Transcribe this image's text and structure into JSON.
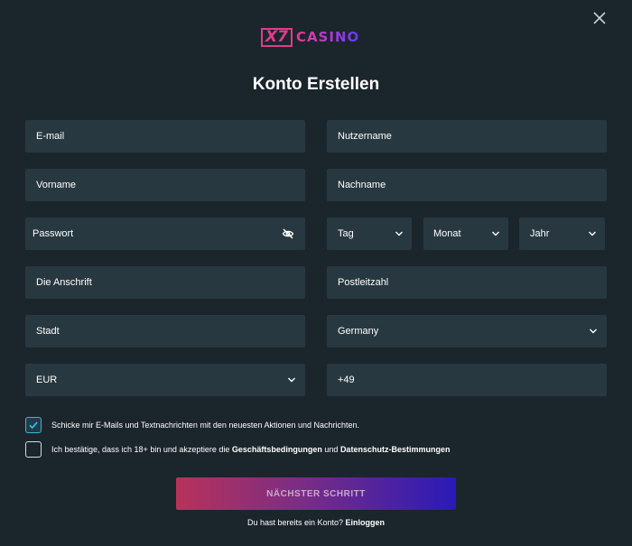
{
  "brand": {
    "logo_mark": "X7",
    "logo_word": "CASINO",
    "colors": {
      "pink": "#e43a8c",
      "purple": "#5a3cf0"
    }
  },
  "title": "Konto Erstellen",
  "fields": {
    "email": "E-mail",
    "username": "Nutzername",
    "first_name": "Vorname",
    "last_name": "Nachname",
    "password": "Passwort",
    "day": "Tag",
    "month": "Monat",
    "year": "Jahr",
    "address": "Die Anschrift",
    "postal_code": "Postleitzahl",
    "city": "Stadt",
    "country": "Germany",
    "currency": "EUR",
    "phone_prefix": "+49"
  },
  "consents": {
    "marketing": {
      "checked": true,
      "text": "Schicke mir E-Mails und Textnachrichten mit den neuesten Aktionen und Nachrichten."
    },
    "terms": {
      "checked": false,
      "prefix": "Ich bestätige, dass ich 18+ bin und akzeptiere die ",
      "terms_link": "Geschäftsbedingungen",
      "middle": " und ",
      "privacy_link": "Datenschutz-Bestimmungen"
    }
  },
  "next_button": "NÄCHSTER SCHRITT",
  "login": {
    "prompt": "Du hast bereits ein Konto? ",
    "link": "Einloggen"
  },
  "icons": {
    "close": "close-icon",
    "eye": "eye-off-icon",
    "chevron": "chevron-down-icon",
    "check": "check-icon"
  }
}
